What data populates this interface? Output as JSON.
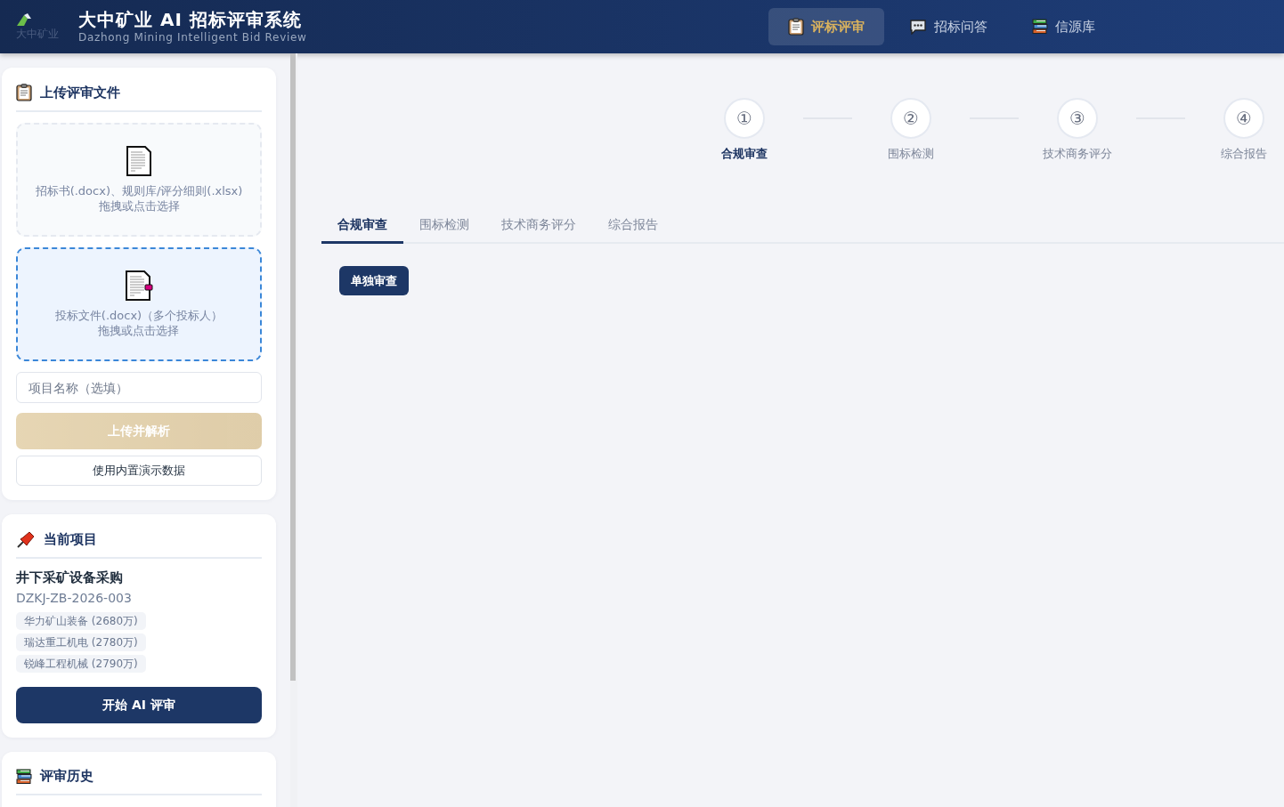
{
  "header": {
    "logo_alt": "大中矿业",
    "title": "大中矿业 AI 招标评审系统",
    "subtitle": "Dazhong Mining Intelligent Bid Review",
    "nav": [
      {
        "label": "评标评审",
        "selected": true
      },
      {
        "label": "招标问答",
        "selected": false
      },
      {
        "label": "信源库",
        "selected": false
      }
    ]
  },
  "sidebar": {
    "upload": {
      "title": "上传评审文件",
      "dropzones": [
        {
          "text": "招标书(.docx)、规则库/评分细则(.xlsx)",
          "hint": "拖拽或点击选择",
          "active": false
        },
        {
          "text": "投标文件(.docx)（多个投标人）",
          "hint": "拖拽或点击选择",
          "active": true
        }
      ],
      "project_field": {
        "placeholder": "项目名称（选填）"
      },
      "upload_button": {
        "label": "上传并解析",
        "disabled": true
      },
      "demo_button": {
        "label": "使用内置演示数据"
      }
    },
    "current_project": {
      "title": "当前项目",
      "name": "井下采矿设备采购",
      "code": "DZKJ-ZB-2026-003",
      "bidders": [
        "华力矿山装备 (2680万)",
        "瑞达重工机电 (2780万)",
        "锐峰工程机械 (2790万)"
      ],
      "start_button": {
        "label": "开始 AI 评审"
      }
    },
    "history": {
      "title": "评审历史"
    }
  },
  "stepper": {
    "steps": [
      {
        "number": "①",
        "label": "合规审查",
        "selected": true
      },
      {
        "number": "②",
        "label": "围标检测",
        "selected": false
      },
      {
        "number": "③",
        "label": "技术商务评分",
        "selected": false
      },
      {
        "number": "④",
        "label": "综合报告",
        "selected": false
      }
    ]
  },
  "tabs": [
    {
      "label": "合规审查",
      "selected": true
    },
    {
      "label": "围标检测",
      "selected": false
    },
    {
      "label": "技术商务评分",
      "selected": false
    },
    {
      "label": "综合报告",
      "selected": false
    }
  ],
  "action_button": {
    "label": "单独审查"
  }
}
